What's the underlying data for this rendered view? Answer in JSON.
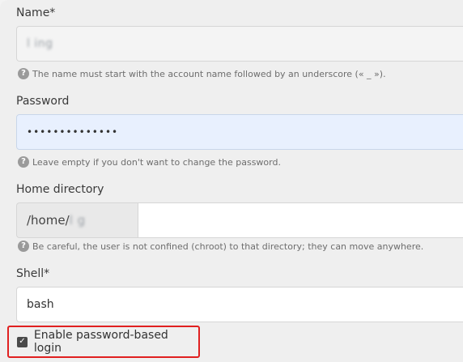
{
  "name": {
    "label": "Name*",
    "value": "",
    "value_blurred": "l  ing",
    "help": "The name must start with the account name followed by an underscore (« _ »)."
  },
  "password": {
    "label": "Password",
    "value": "••••••••••••••",
    "help": "Leave empty if you don't want to change the password."
  },
  "home": {
    "label": "Home directory",
    "prefix": "/home/",
    "prefix_blurred": "l     g",
    "help": "Be careful, the user is not confined (chroot) to that directory; they can move anywhere."
  },
  "shell": {
    "label": "Shell*",
    "value": "bash"
  },
  "password_login": {
    "label": "Enable password-based login",
    "checked": true
  },
  "icons": {
    "help": "?",
    "check": "✓"
  }
}
